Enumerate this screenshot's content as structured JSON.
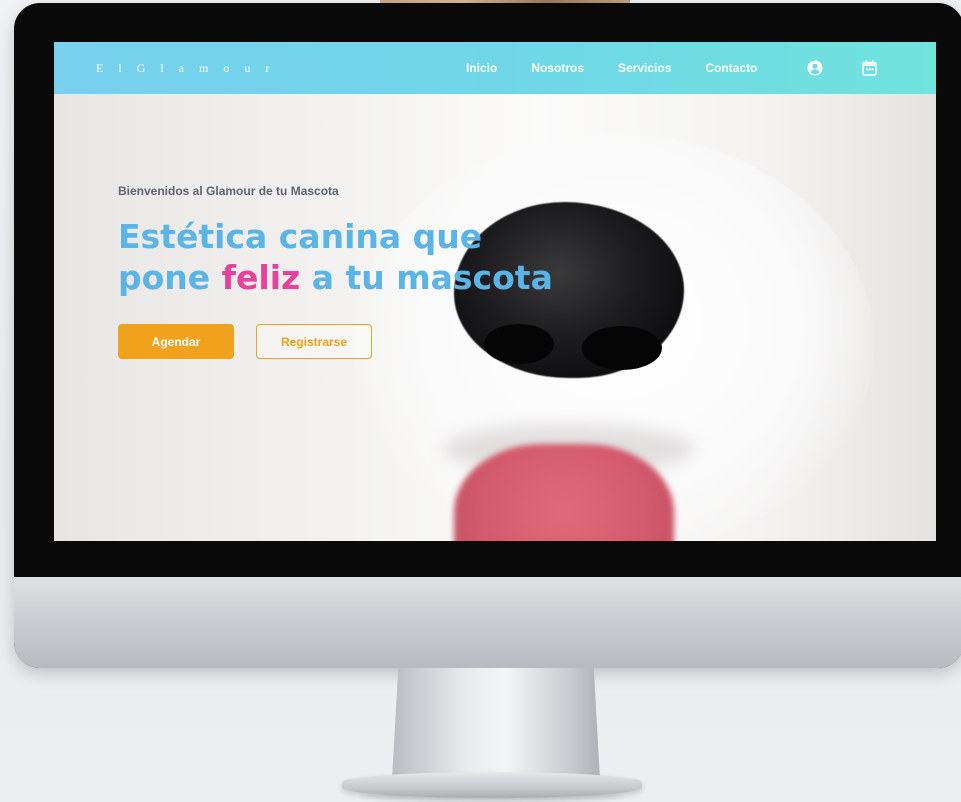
{
  "nav": {
    "brand": "E l G l a m o u r",
    "links": [
      "Inicio",
      "Nosotros",
      "Servicios",
      "Contacto"
    ],
    "icons": [
      "user-icon",
      "calendar-icon"
    ]
  },
  "hero": {
    "welcome": "Bienvenidos al Glamour de tu Mascota",
    "headline_line1": "Estética canina que",
    "headline_line2_pre": "pone",
    "headline_highlight": "feliz",
    "headline_line2_post": "a tu mascota",
    "primary_button": "Agendar",
    "secondary_button": "Registrarse"
  },
  "colors": {
    "nav_gradient_start": "#78d0ee",
    "nav_gradient_end": "#6fe3dc",
    "headline_blue": "#5ab4e6",
    "highlight_pink": "#e8419b",
    "button_orange": "#f0a21c",
    "welcome_text": "#5e6470"
  }
}
